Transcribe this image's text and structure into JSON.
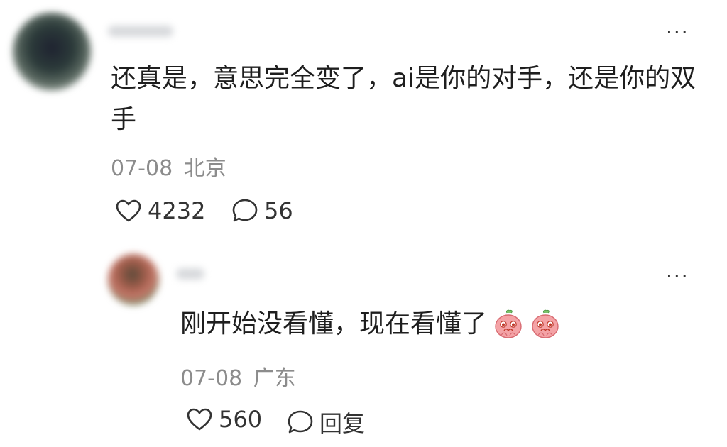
{
  "comment": {
    "text": "还真是，意思完全变了，ai是你的对手，还是你的双手",
    "date": "07-08",
    "location": "北京",
    "likes": "4232",
    "replies": "56",
    "more_label": "···"
  },
  "reply": {
    "text": "刚开始没看懂，现在看懂了",
    "emojis": [
      "peach-face-emoji",
      "peach-face-emoji"
    ],
    "date": "07-08",
    "location": "广东",
    "likes": "560",
    "reply_label": "回复",
    "more_label": "···"
  },
  "colors": {
    "text": "#1e1e1e",
    "meta": "#8c8c8c",
    "icon": "#333333",
    "emoji_pink": "#f4a3a6"
  }
}
